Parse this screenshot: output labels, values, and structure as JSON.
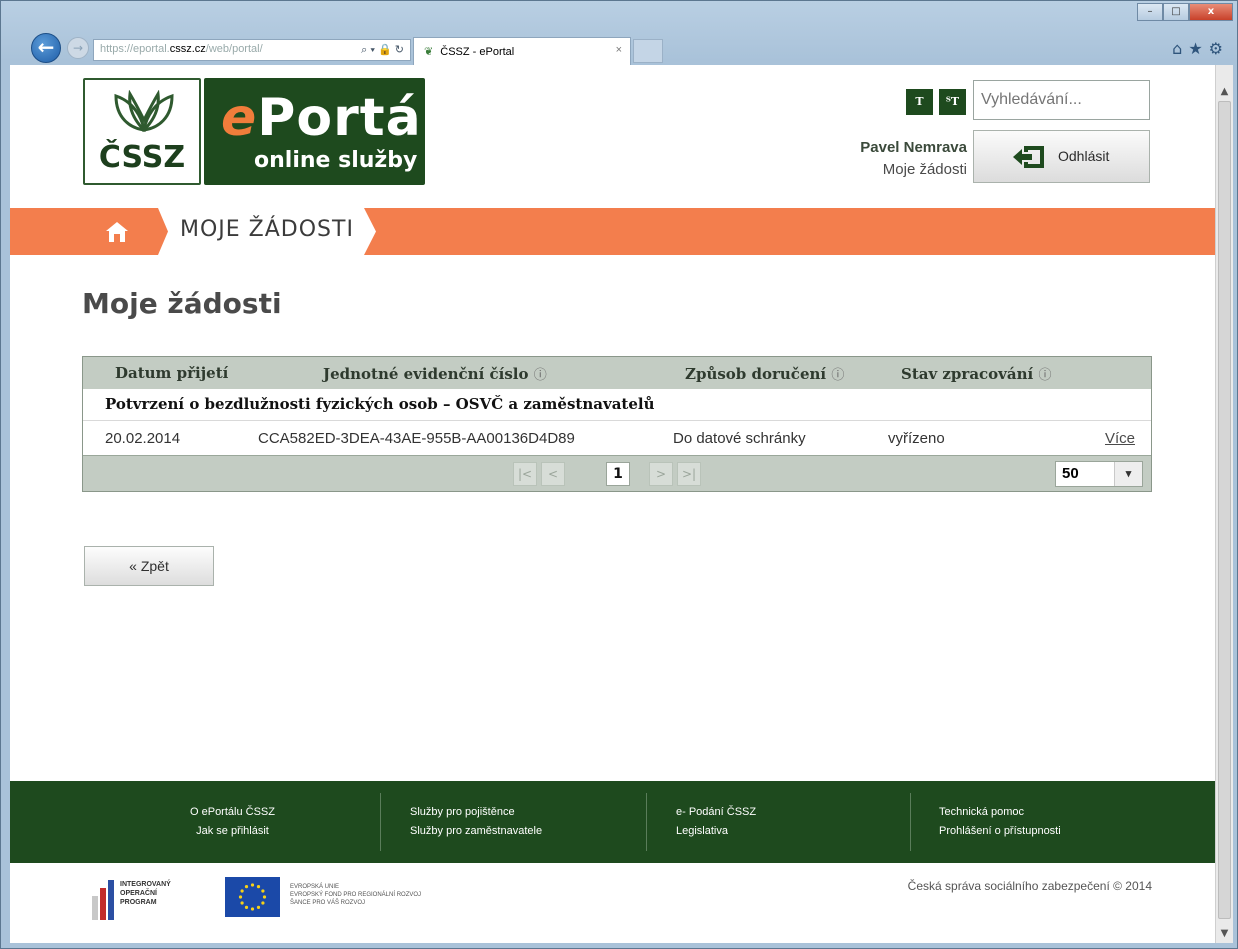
{
  "browser": {
    "address_prefix": "https://eportal.",
    "address_domain": "cssz.cz",
    "address_path": "/web/portal/",
    "address_tools": "⌕ ▾ 🔒 ↻",
    "tab_title": "ČSSZ - ePortal",
    "tab_close": "×",
    "back_glyph": "←",
    "forward_glyph": "→",
    "icons": "⌂★⚙",
    "win_min": "–",
    "win_max": "□",
    "win_close": "x"
  },
  "header": {
    "logo_cssz_text": "ČSSZ",
    "logo_e": "e",
    "logo_portal": "Portál",
    "logo_subtitle": "online služby",
    "font_btn_1": "T",
    "font_btn_2": "ᵀT",
    "search_placeholder": "Vyhledávání...",
    "user_name": "Pavel Nemrava",
    "user_link": "Moje žádosti",
    "logout_label": "Odhlásit"
  },
  "nav": {
    "breadcrumb": "MOJE ŽÁDOSTI"
  },
  "main": {
    "title": "Moje žádosti",
    "table": {
      "columns": [
        "Datum přijetí",
        "Jednotné evidenční číslo",
        "Způsob doručení",
        "Stav zpracování"
      ],
      "info_glyph": "ⓘ",
      "group_title": "Potvrzení o bezdlužnosti fyzických osob – OSVČ a zaměstnavatelů",
      "rows": [
        {
          "date": "20.02.2014",
          "jec": "CCA582ED-3DEA-43AE-955B-AA00136D4D89",
          "delivery": "Do datové schránky",
          "status": "vyřízeno",
          "link": "Více"
        }
      ],
      "pager": {
        "first": "|<",
        "prev": "<",
        "current": "1",
        "next": ">",
        "last": ">|",
        "per_page": "50",
        "per_page_arrow": "▾"
      }
    },
    "back_button": "« Zpět"
  },
  "footer": {
    "col1": [
      "O ePortálu ČSSZ",
      "Jak se přihlásit"
    ],
    "col2": [
      "Služby pro pojištěnce",
      "Služby pro zaměstnavatele"
    ],
    "col3": [
      "e- Podání ČSSZ",
      "Legislativa"
    ],
    "col4": [
      "Technická pomoc",
      "Prohlášení o přístupnosti"
    ],
    "iop_lines": [
      "INTEGROVANÝ",
      "OPERAČNÍ",
      "PROGRAM"
    ],
    "eu_lines": [
      "EVROPSKÁ UNIE",
      "EVROPSKÝ FOND PRO REGIONÁLNÍ ROZVOJ",
      "ŠANCE PRO VÁŠ ROZVOJ"
    ],
    "copyright": "Česká správa sociálního zabezpečení © 2014"
  },
  "colors": {
    "brand_green": "#1e4a1e",
    "accent_orange": "#f37e4d",
    "table_header": "#c3ccc3"
  }
}
